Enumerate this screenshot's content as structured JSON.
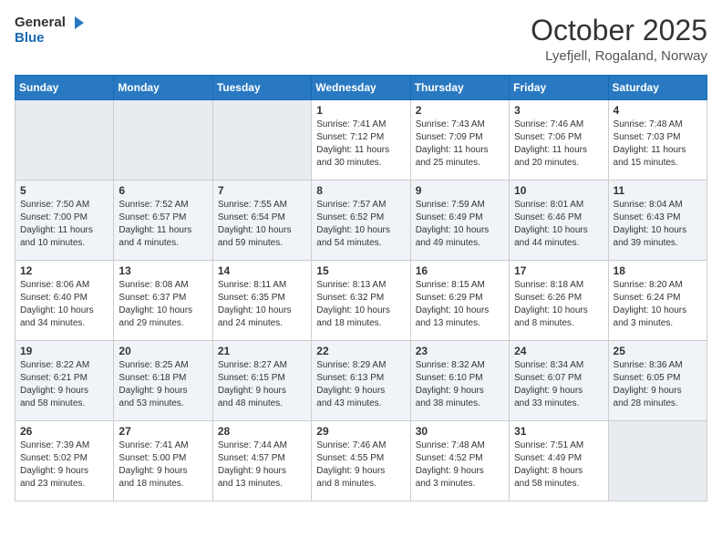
{
  "header": {
    "logo_general": "General",
    "logo_blue": "Blue",
    "month_title": "October 2025",
    "location": "Lyefjell, Rogaland, Norway"
  },
  "days_of_week": [
    "Sunday",
    "Monday",
    "Tuesday",
    "Wednesday",
    "Thursday",
    "Friday",
    "Saturday"
  ],
  "weeks": [
    [
      {
        "day": "",
        "empty": true
      },
      {
        "day": "",
        "empty": true
      },
      {
        "day": "",
        "empty": true
      },
      {
        "day": "1",
        "sunrise": "7:41 AM",
        "sunset": "7:12 PM",
        "daylight": "11 hours and 30 minutes."
      },
      {
        "day": "2",
        "sunrise": "7:43 AM",
        "sunset": "7:09 PM",
        "daylight": "11 hours and 25 minutes."
      },
      {
        "day": "3",
        "sunrise": "7:46 AM",
        "sunset": "7:06 PM",
        "daylight": "11 hours and 20 minutes."
      },
      {
        "day": "4",
        "sunrise": "7:48 AM",
        "sunset": "7:03 PM",
        "daylight": "11 hours and 15 minutes."
      }
    ],
    [
      {
        "day": "5",
        "sunrise": "7:50 AM",
        "sunset": "7:00 PM",
        "daylight": "11 hours and 10 minutes."
      },
      {
        "day": "6",
        "sunrise": "7:52 AM",
        "sunset": "6:57 PM",
        "daylight": "11 hours and 4 minutes."
      },
      {
        "day": "7",
        "sunrise": "7:55 AM",
        "sunset": "6:54 PM",
        "daylight": "10 hours and 59 minutes."
      },
      {
        "day": "8",
        "sunrise": "7:57 AM",
        "sunset": "6:52 PM",
        "daylight": "10 hours and 54 minutes."
      },
      {
        "day": "9",
        "sunrise": "7:59 AM",
        "sunset": "6:49 PM",
        "daylight": "10 hours and 49 minutes."
      },
      {
        "day": "10",
        "sunrise": "8:01 AM",
        "sunset": "6:46 PM",
        "daylight": "10 hours and 44 minutes."
      },
      {
        "day": "11",
        "sunrise": "8:04 AM",
        "sunset": "6:43 PM",
        "daylight": "10 hours and 39 minutes."
      }
    ],
    [
      {
        "day": "12",
        "sunrise": "8:06 AM",
        "sunset": "6:40 PM",
        "daylight": "10 hours and 34 minutes."
      },
      {
        "day": "13",
        "sunrise": "8:08 AM",
        "sunset": "6:37 PM",
        "daylight": "10 hours and 29 minutes."
      },
      {
        "day": "14",
        "sunrise": "8:11 AM",
        "sunset": "6:35 PM",
        "daylight": "10 hours and 24 minutes."
      },
      {
        "day": "15",
        "sunrise": "8:13 AM",
        "sunset": "6:32 PM",
        "daylight": "10 hours and 18 minutes."
      },
      {
        "day": "16",
        "sunrise": "8:15 AM",
        "sunset": "6:29 PM",
        "daylight": "10 hours and 13 minutes."
      },
      {
        "day": "17",
        "sunrise": "8:18 AM",
        "sunset": "6:26 PM",
        "daylight": "10 hours and 8 minutes."
      },
      {
        "day": "18",
        "sunrise": "8:20 AM",
        "sunset": "6:24 PM",
        "daylight": "10 hours and 3 minutes."
      }
    ],
    [
      {
        "day": "19",
        "sunrise": "8:22 AM",
        "sunset": "6:21 PM",
        "daylight": "9 hours and 58 minutes."
      },
      {
        "day": "20",
        "sunrise": "8:25 AM",
        "sunset": "6:18 PM",
        "daylight": "9 hours and 53 minutes."
      },
      {
        "day": "21",
        "sunrise": "8:27 AM",
        "sunset": "6:15 PM",
        "daylight": "9 hours and 48 minutes."
      },
      {
        "day": "22",
        "sunrise": "8:29 AM",
        "sunset": "6:13 PM",
        "daylight": "9 hours and 43 minutes."
      },
      {
        "day": "23",
        "sunrise": "8:32 AM",
        "sunset": "6:10 PM",
        "daylight": "9 hours and 38 minutes."
      },
      {
        "day": "24",
        "sunrise": "8:34 AM",
        "sunset": "6:07 PM",
        "daylight": "9 hours and 33 minutes."
      },
      {
        "day": "25",
        "sunrise": "8:36 AM",
        "sunset": "6:05 PM",
        "daylight": "9 hours and 28 minutes."
      }
    ],
    [
      {
        "day": "26",
        "sunrise": "7:39 AM",
        "sunset": "5:02 PM",
        "daylight": "9 hours and 23 minutes."
      },
      {
        "day": "27",
        "sunrise": "7:41 AM",
        "sunset": "5:00 PM",
        "daylight": "9 hours and 18 minutes."
      },
      {
        "day": "28",
        "sunrise": "7:44 AM",
        "sunset": "4:57 PM",
        "daylight": "9 hours and 13 minutes."
      },
      {
        "day": "29",
        "sunrise": "7:46 AM",
        "sunset": "4:55 PM",
        "daylight": "9 hours and 8 minutes."
      },
      {
        "day": "30",
        "sunrise": "7:48 AM",
        "sunset": "4:52 PM",
        "daylight": "9 hours and 3 minutes."
      },
      {
        "day": "31",
        "sunrise": "7:51 AM",
        "sunset": "4:49 PM",
        "daylight": "8 hours and 58 minutes."
      },
      {
        "day": "",
        "empty": true
      }
    ]
  ]
}
